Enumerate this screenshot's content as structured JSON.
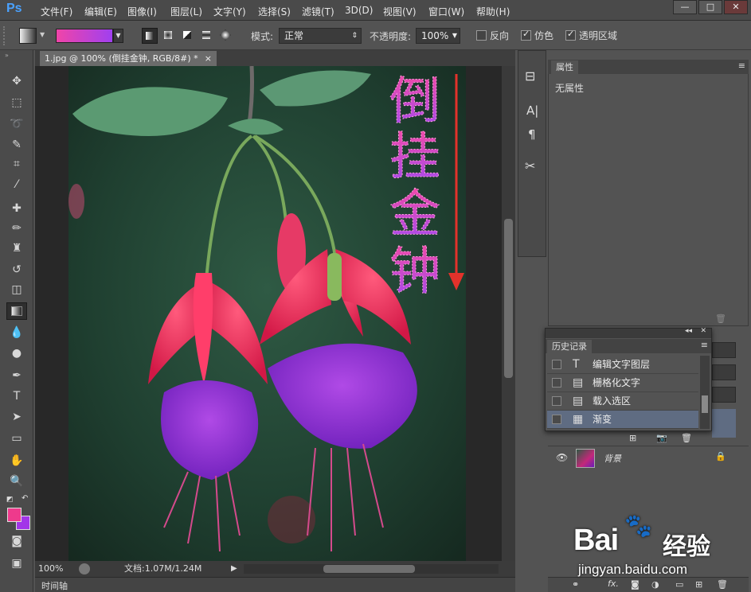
{
  "menubar": {
    "logo": "Ps",
    "items": [
      "文件(F)",
      "编辑(E)",
      "图像(I)",
      "图层(L)",
      "文字(Y)",
      "选择(S)",
      "滤镜(T)",
      "3D(D)",
      "视图(V)",
      "窗口(W)",
      "帮助(H)"
    ],
    "min": "—",
    "max": "□",
    "close": "✕"
  },
  "options": {
    "mode_label": "模式:",
    "mode_value": "正常",
    "opacity_label": "不透明度:",
    "opacity_value": "100%",
    "reverse": "反向",
    "dither": "仿色",
    "transparency": "透明区域",
    "gradient_start": "#f044a8",
    "gradient_end": "#a040f0"
  },
  "doc": {
    "tab_title": "1.jpg @ 100% (倒挂金钟, RGB/8#) *",
    "tab_close": "×"
  },
  "artwork": {
    "text_chars": [
      "倒",
      "挂",
      "金",
      "钟"
    ]
  },
  "status": {
    "zoom": "100%",
    "doc_size": "文档:1.07M/1.24M"
  },
  "timeline": {
    "label": "时间轴"
  },
  "properties": {
    "tab": "属性",
    "content": "无属性"
  },
  "history": {
    "tab": "历史记录",
    "items": [
      {
        "label": "编辑文字图层",
        "icon": "T"
      },
      {
        "label": "栅格化文字",
        "icon": "▤"
      },
      {
        "label": "载入选区",
        "icon": "▤"
      },
      {
        "label": "渐变",
        "icon": "▦"
      }
    ]
  },
  "layers": {
    "bg_name": "背景"
  },
  "colors": {
    "foreground": "#ee3a8c",
    "background": "#a235e8"
  },
  "watermark": {
    "brand": "Bai",
    "brand2": "经验",
    "url": "jingyan.baidu.com"
  }
}
